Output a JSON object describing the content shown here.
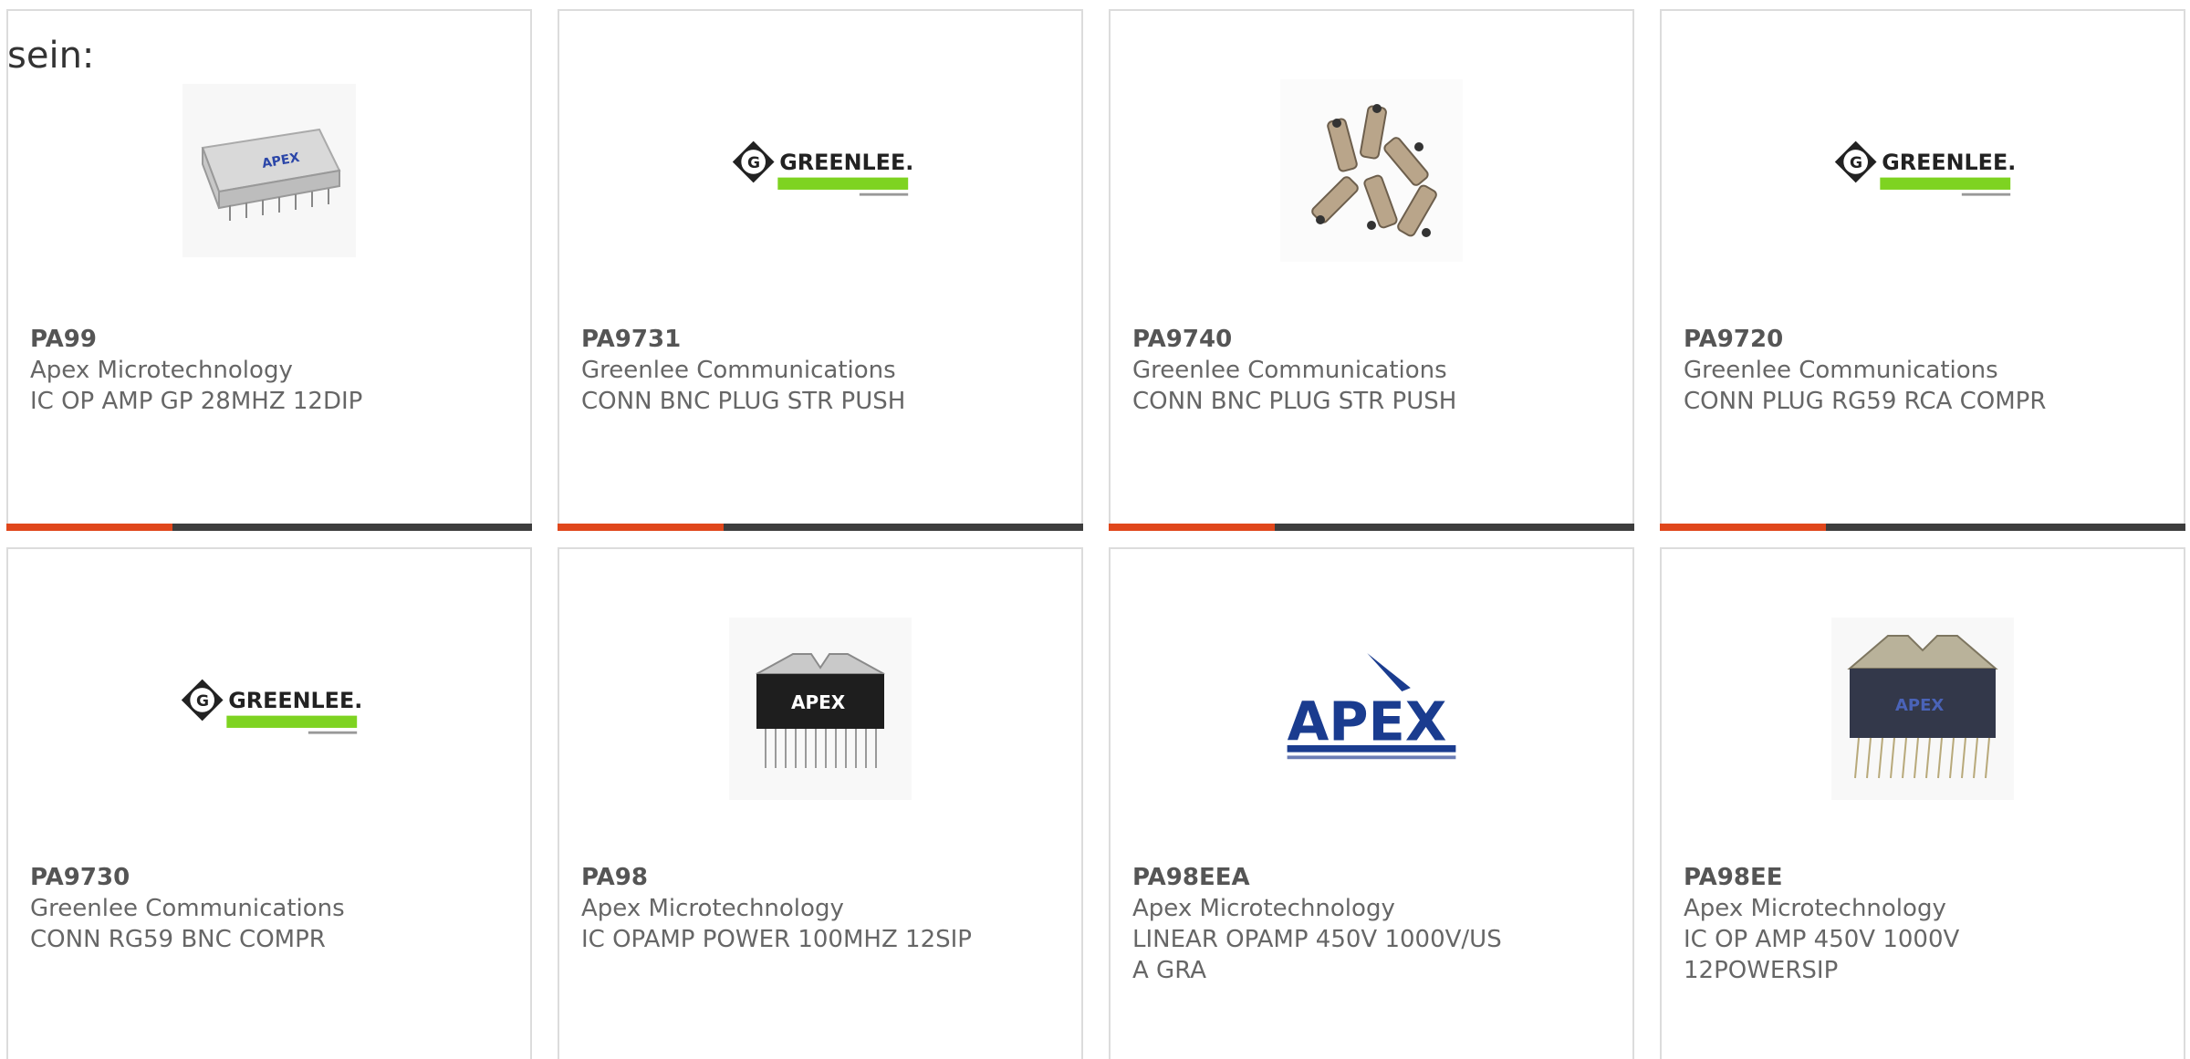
{
  "lead_text": "sein:",
  "colors": {
    "accent": "#e0471c",
    "bar": "#3d3d3d",
    "border": "#dcdcdc",
    "greenlee_green": "#7ed321",
    "apex_blue": "#1a3c8f"
  },
  "products": [
    {
      "part": "PA99",
      "manufacturer": "Apex Microtechnology",
      "description": "IC OP AMP GP 28MHZ 12DIP",
      "image": "apex-dip-package",
      "image_text": "APEX"
    },
    {
      "part": "PA9731",
      "manufacturer": "Greenlee Communications",
      "description": "CONN BNC PLUG STR PUSH",
      "image": "greenlee-logo",
      "image_text": "GREENLEE."
    },
    {
      "part": "PA9740",
      "manufacturer": "Greenlee Communications",
      "description": "CONN BNC PLUG STR PUSH",
      "image": "bnc-connectors-photo"
    },
    {
      "part": "PA9720",
      "manufacturer": "Greenlee Communications",
      "description": "CONN PLUG RG59 RCA COMPR",
      "image": "greenlee-logo",
      "image_text": "GREENLEE."
    },
    {
      "part": "PA9730",
      "manufacturer": "Greenlee Communications",
      "description": "CONN RG59 BNC COMPR",
      "image": "greenlee-logo",
      "image_text": "GREENLEE."
    },
    {
      "part": "PA98",
      "manufacturer": "Apex Microtechnology",
      "description": "IC OPAMP POWER 100MHZ 12SIP",
      "image": "apex-sip-package",
      "image_text": "APEX"
    },
    {
      "part": "PA98EEA",
      "manufacturer": "Apex Microtechnology",
      "description": "LINEAR OPAMP 450V 1000V/US A GRA",
      "image": "apex-logo",
      "image_text": "APEX"
    },
    {
      "part": "PA98EE",
      "manufacturer": "Apex Microtechnology",
      "description": "IC OP AMP 450V 1000V 12POWERSIP",
      "image": "apex-powersip-package",
      "image_text": "APEX"
    }
  ]
}
